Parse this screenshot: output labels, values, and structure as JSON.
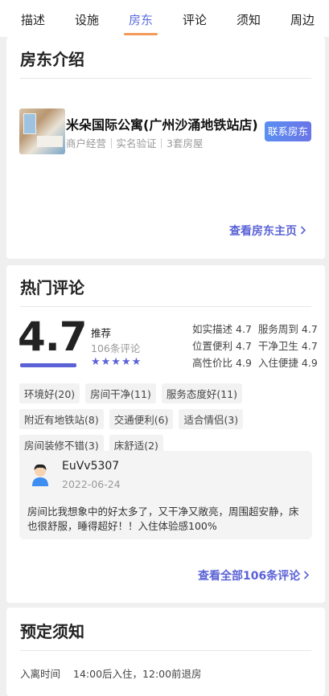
{
  "tabs": [
    {
      "label": "描述",
      "active": false
    },
    {
      "label": "设施",
      "active": false
    },
    {
      "label": "房东",
      "active": true
    },
    {
      "label": "评论",
      "active": false
    },
    {
      "label": "须知",
      "active": false
    },
    {
      "label": "周边",
      "active": false
    }
  ],
  "host": {
    "section_title": "房东介绍",
    "name": "米朵国际公寓(广州沙涌地铁站店)",
    "meta": "商户经营｜实名验证｜3套房屋",
    "contact_label": "联系房东",
    "homepage_link": "查看房东主页",
    "accent": "#5a62d6"
  },
  "reviews": {
    "section_title": "热门评论",
    "score": "4.7",
    "recommend_label": "推荐",
    "count_label": "106条评论",
    "stars": "★★★★★",
    "star_rating": 4.7,
    "sub_scores": [
      [
        {
          "label": "如实描述",
          "value": "4.7"
        },
        {
          "label": "服务周到",
          "value": "4.7"
        }
      ],
      [
        {
          "label": "位置便利",
          "value": "4.7"
        },
        {
          "label": "干净卫生",
          "value": "4.7"
        }
      ],
      [
        {
          "label": "高性价比",
          "value": "4.9"
        },
        {
          "label": "入住便捷",
          "value": "4.9"
        }
      ]
    ],
    "tags": [
      "环境好(20)",
      "房间干净(11)",
      "服务态度好(11)",
      "附近有地铁站(8)",
      "交通便利(6)",
      "适合情侣(3)",
      "房间装修不错(3)",
      "床舒适(2)"
    ],
    "featured": {
      "user": "EuVv5307",
      "date": "2022-06-24",
      "text": "房间比我想象中的好太多了，又干净又敞亮，周围超安静，床也很舒服，睡得超好！！入住体验感100%"
    },
    "all_reviews_link": "查看全部106条评论"
  },
  "notice": {
    "section_title": "预定须知",
    "checkin_label": "入离时间",
    "checkin_value": "14:00后入住，12:00前退房"
  }
}
